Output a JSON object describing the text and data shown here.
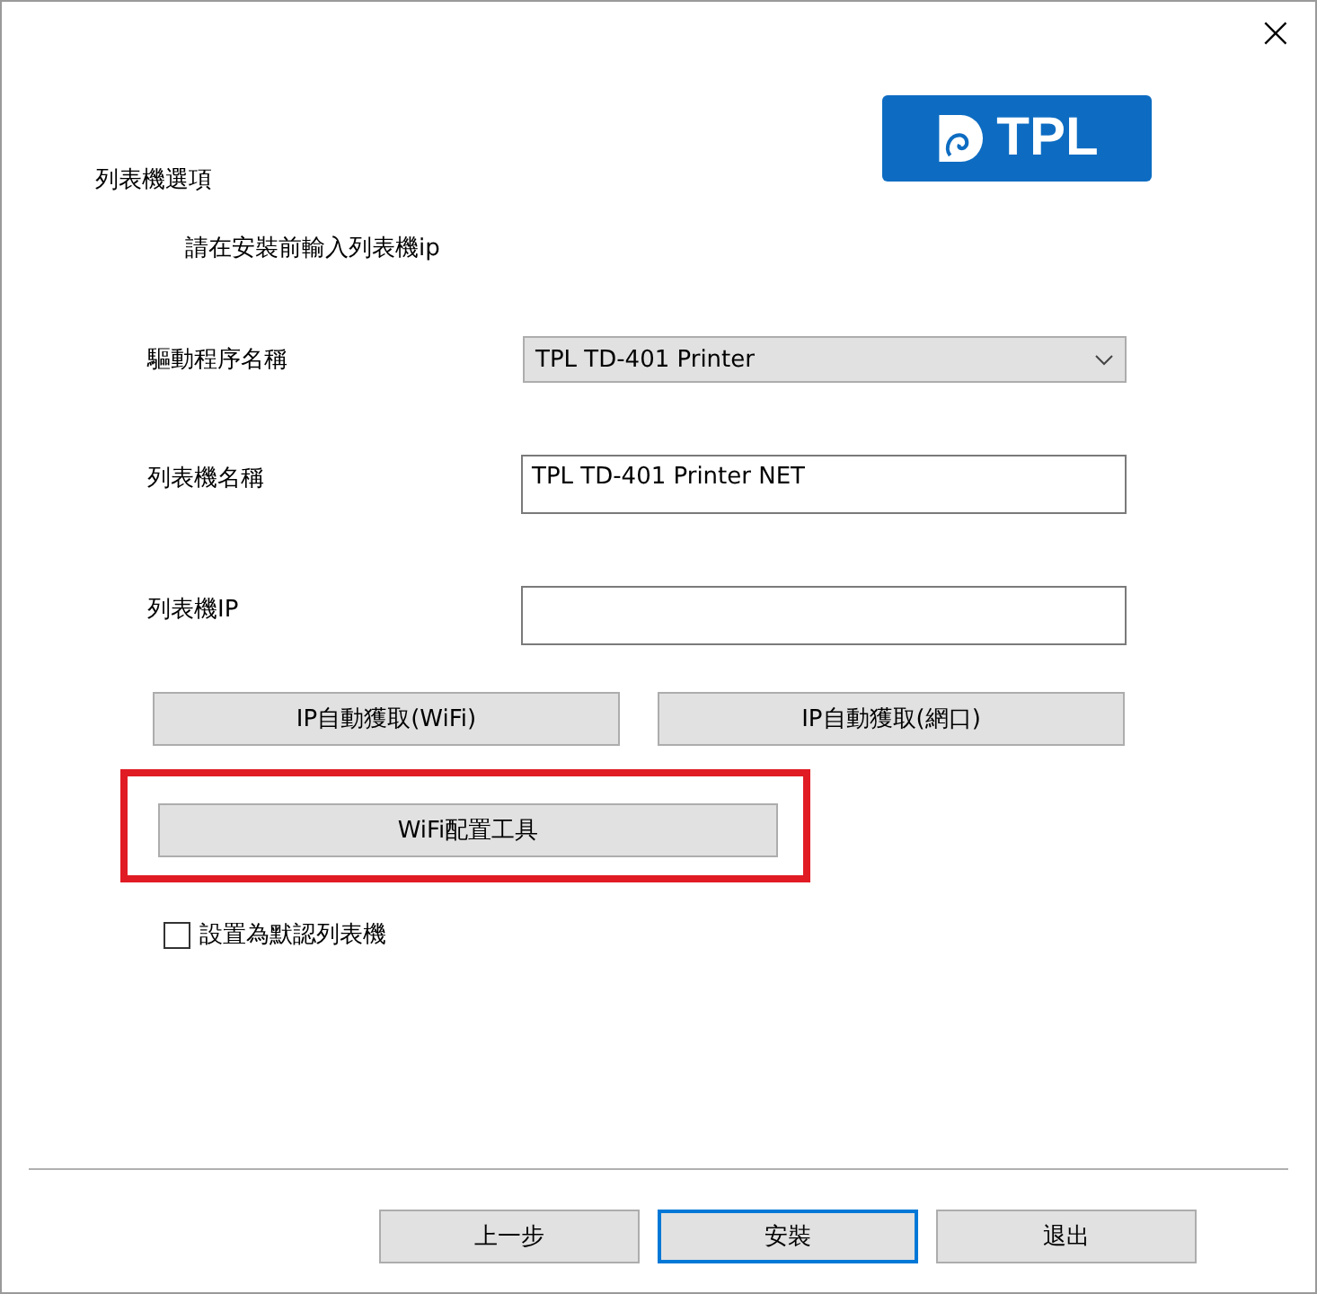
{
  "window": {
    "close": "×"
  },
  "logo": {
    "text": "TPL"
  },
  "title": "列表機選項",
  "subtitle": "請在安裝前輸入列表機ip",
  "fields": [
    {
      "kind": "dropdown",
      "label": "驅動程序名稱",
      "value": "TPL TD-401 Printer"
    },
    {
      "kind": "text",
      "label": "列表機名稱",
      "value": "TPL TD-401 Printer NET"
    },
    {
      "kind": "text",
      "label": "列表機IP"
    }
  ],
  "ip_buttons": [
    {
      "label": "IP自動獲取(WiFi)"
    },
    {
      "label": "IP自動獲取(網口)"
    }
  ],
  "tool_button": {
    "label": "WiFi配置工具",
    "highlighted": true
  },
  "default_checkbox": {
    "label": "設置為默認列表機",
    "checked": false
  },
  "footer_buttons": [
    {
      "label": "上一步",
      "focused": false
    },
    {
      "label": "安裝",
      "focused": true
    },
    {
      "label": "退出",
      "focused": false
    }
  ]
}
